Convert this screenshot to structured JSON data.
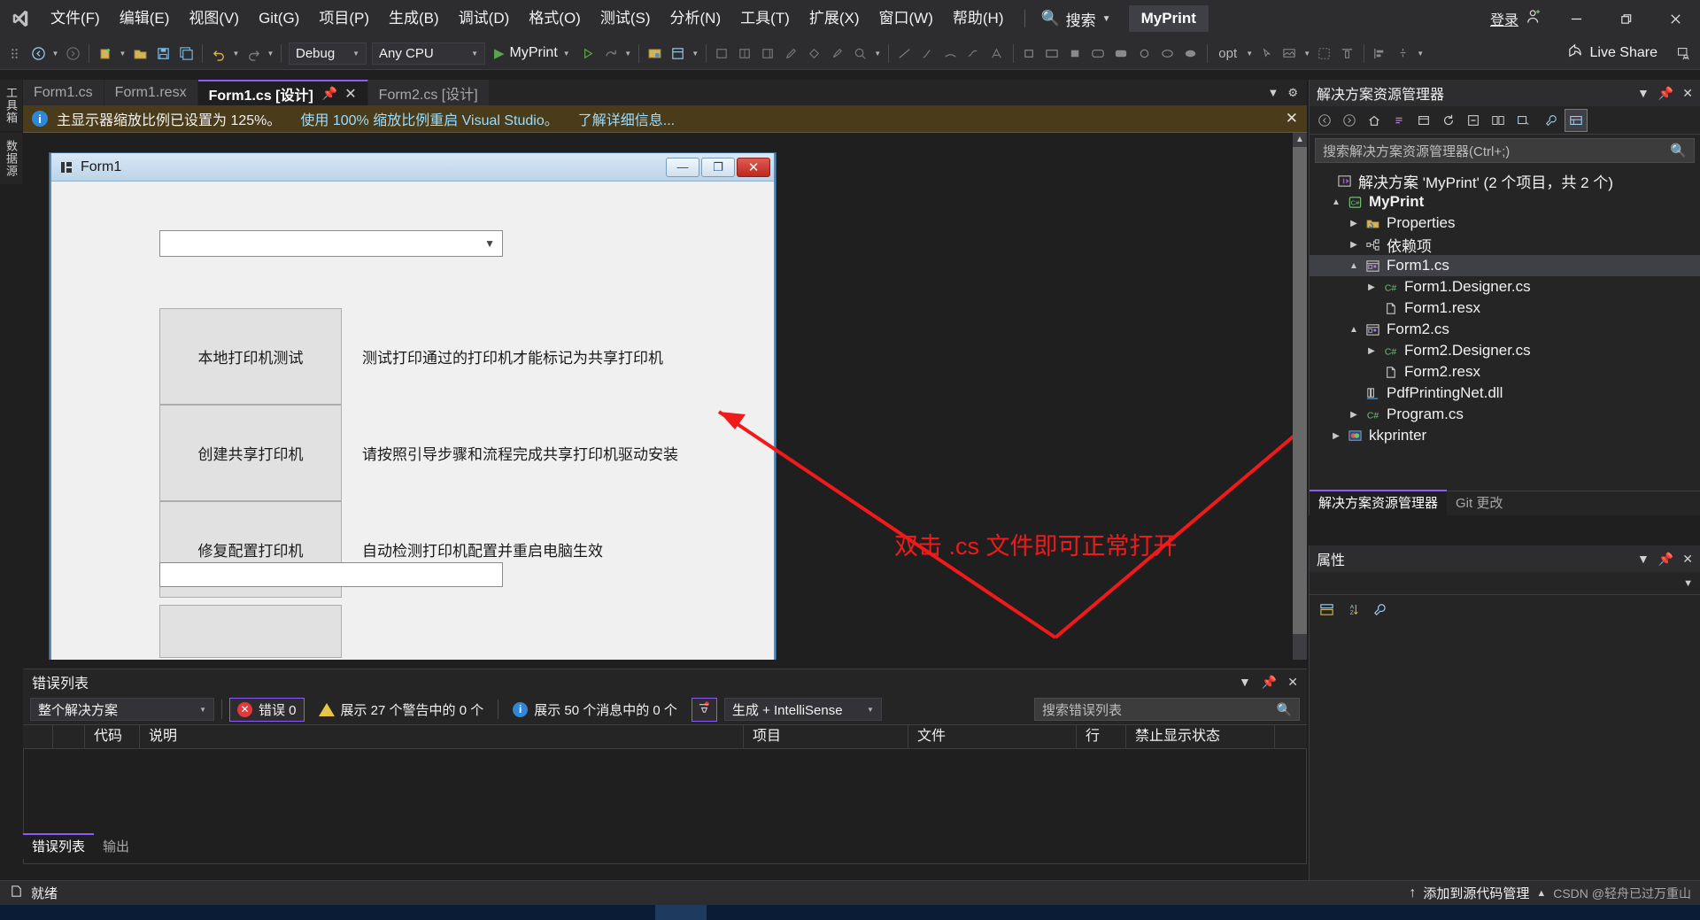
{
  "app": {
    "logo_icon": "visual-studio-logo",
    "project_chip": "MyPrint",
    "sign_in_label": "登录",
    "sign_in_icon": "add-account-icon",
    "minimize_icon": "minimize-icon",
    "maximize_icon": "restore-icon",
    "close_icon": "close-icon"
  },
  "menu": {
    "items": [
      {
        "label": "文件(F)"
      },
      {
        "label": "编辑(E)"
      },
      {
        "label": "视图(V)"
      },
      {
        "label": "Git(G)"
      },
      {
        "label": "项目(P)"
      },
      {
        "label": "生成(B)"
      },
      {
        "label": "调试(D)"
      },
      {
        "label": "格式(O)"
      },
      {
        "label": "测试(S)"
      },
      {
        "label": "分析(N)"
      },
      {
        "label": "工具(T)"
      },
      {
        "label": "扩展(X)"
      },
      {
        "label": "窗口(W)"
      },
      {
        "label": "帮助(H)"
      }
    ],
    "search_label": "搜索",
    "search_icon": "magnifier-icon"
  },
  "toolbar": {
    "config_combo": "Debug",
    "platform_combo": "Any CPU",
    "run_label": "MyPrint",
    "run_icon": "play-icon",
    "opt_label": "opt",
    "live_share_label": "Live Share",
    "live_share_icon": "share-icon"
  },
  "vertical_tabs": [
    {
      "label": "工具箱"
    },
    {
      "label": "数据源"
    }
  ],
  "document_tabs": [
    {
      "label": "Form1.cs",
      "active": false
    },
    {
      "label": "Form1.resx",
      "active": false
    },
    {
      "label": "Form1.cs [设计]",
      "active": true
    },
    {
      "label": "Form2.cs [设计]",
      "active": false
    }
  ],
  "tab_strip_controls": {
    "dropdown_icon": "chevron-down-icon",
    "settings_icon": "gear-icon"
  },
  "info_bar": {
    "icon": "info-icon",
    "message": "主显示器缩放比例已设置为 125%。",
    "link": "使用 100% 缩放比例重启 Visual Studio。",
    "link2": "了解详细信息...",
    "close_icon": "close-icon"
  },
  "winform": {
    "title": "Form1",
    "title_icon": "form-icon",
    "minimize_label": "—",
    "maximize_label": "❐",
    "close_label": "✕",
    "combo_value": "",
    "combo_chevron": "chevron-down-icon",
    "rows": [
      {
        "button": "本地打印机测试",
        "desc": "测试打印通过的打印机才能标记为共享打印机"
      },
      {
        "button": "创建共享打印机",
        "desc": "请按照引导步骤和流程完成共享打印机驱动安装"
      },
      {
        "button": "修复配置打印机",
        "desc": "自动检测打印机配置并重启电脑生效"
      }
    ],
    "textbox_value": ""
  },
  "annotation": {
    "text": "双击 .cs 文件即可正常打开",
    "color": "#f01a1a"
  },
  "solution_explorer": {
    "title": "解决方案资源管理器",
    "search_placeholder": "搜索解决方案资源管理器(Ctrl+;)",
    "search_icon": "magnifier-icon",
    "toolbar_icons": [
      "back-icon",
      "forward-icon",
      "home-icon",
      "refresh-icon",
      "pending-changes-icon",
      "show-all-files-icon",
      "collapse-all-icon",
      "properties-window-icon",
      "view-selector-icon",
      "wrench-icon",
      "preview-icon"
    ],
    "panel_controls": {
      "dropdown_icon": "chevron-down-icon",
      "pin_icon": "pin-icon",
      "close_icon": "close-icon"
    },
    "tree": [
      {
        "label": "解决方案 'MyPrint' (2 个项目，共 2 个)",
        "indent": 0,
        "expander": "",
        "icon": "solution-icon",
        "bold": false,
        "selected": false
      },
      {
        "label": "MyPrint",
        "indent": 1,
        "expander": "▲",
        "icon": "csharp-project-icon",
        "bold": true,
        "selected": false
      },
      {
        "label": "Properties",
        "indent": 2,
        "expander": "▶",
        "icon": "properties-folder-icon",
        "bold": false,
        "selected": false
      },
      {
        "label": "依赖项",
        "indent": 2,
        "expander": "▶",
        "icon": "dependencies-icon",
        "bold": false,
        "selected": false
      },
      {
        "label": "Form1.cs",
        "indent": 2,
        "expander": "▲",
        "icon": "form-file-icon",
        "bold": false,
        "selected": true
      },
      {
        "label": "Form1.Designer.cs",
        "indent": 3,
        "expander": "▶",
        "icon": "csharp-file-icon",
        "bold": false,
        "selected": false
      },
      {
        "label": "Form1.resx",
        "indent": 3,
        "expander": "",
        "icon": "resx-file-icon",
        "bold": false,
        "selected": false
      },
      {
        "label": "Form2.cs",
        "indent": 2,
        "expander": "▲",
        "icon": "form-file-icon",
        "bold": false,
        "selected": false
      },
      {
        "label": "Form2.Designer.cs",
        "indent": 3,
        "expander": "▶",
        "icon": "csharp-file-icon",
        "bold": false,
        "selected": false
      },
      {
        "label": "Form2.resx",
        "indent": 3,
        "expander": "",
        "icon": "resx-file-icon",
        "bold": false,
        "selected": false
      },
      {
        "label": "PdfPrintingNet.dll",
        "indent": 2,
        "expander": "",
        "icon": "library-icon",
        "bold": false,
        "selected": false
      },
      {
        "label": "Program.cs",
        "indent": 2,
        "expander": "▶",
        "icon": "csharp-file-icon",
        "bold": false,
        "selected": false
      },
      {
        "label": "kkprinter",
        "indent": 1,
        "expander": "▶",
        "icon": "cpp-project-icon",
        "bold": false,
        "selected": false
      }
    ],
    "bottom_tabs": [
      {
        "label": "解决方案资源管理器",
        "active": true
      },
      {
        "label": "Git 更改",
        "active": false
      }
    ]
  },
  "properties_panel": {
    "title": "属性",
    "panel_controls": {
      "dropdown_icon": "chevron-down-icon",
      "pin_icon": "pin-icon",
      "close_icon": "close-icon"
    },
    "toolbar_icons": [
      "categorized-icon",
      "alphabetical-icon",
      "properties-icon"
    ]
  },
  "error_list": {
    "title": "错误列表",
    "panel_controls": {
      "dropdown_icon": "chevron-down-icon",
      "pin_icon": "pin-icon",
      "close_icon": "close-icon"
    },
    "scope_combo": "整个解决方案",
    "errors_label": "错误 0",
    "errors_icon": "error-icon",
    "warnings_label": "展示 27 个警告中的 0 个",
    "warnings_icon": "warning-icon",
    "messages_label": "展示 50 个消息中的 0 个",
    "messages_icon": "info-icon",
    "filter_icon": "filter-icon",
    "build_combo": "生成 + IntelliSense",
    "search_placeholder": "搜索错误列表",
    "search_icon": "magnifier-icon",
    "columns": [
      "",
      "",
      "代码",
      "说明",
      "项目",
      "文件",
      "行",
      "禁止显示状态"
    ],
    "rows": [],
    "bottom_tabs": [
      {
        "label": "错误列表",
        "active": true
      },
      {
        "label": "输出",
        "active": false
      }
    ]
  },
  "status_bar": {
    "icon": "source-control-icon",
    "ready_label": "就绪",
    "add_to_scm_label": "添加到源代码管理",
    "add_to_scm_icon": "up-arrow-icon",
    "watermark": "CSDN @轻舟已过万重山"
  },
  "colors": {
    "accent_purple": "#8b5cf6",
    "chrome_bg": "#2d2d30",
    "panel_bg": "#252526",
    "editor_bg": "#1f1f1f",
    "info_bar_bg": "#4a3c1a",
    "annotation_red": "#f01a1a",
    "run_green": "#57a64a",
    "form_titlebar": "#bcd4e8"
  }
}
